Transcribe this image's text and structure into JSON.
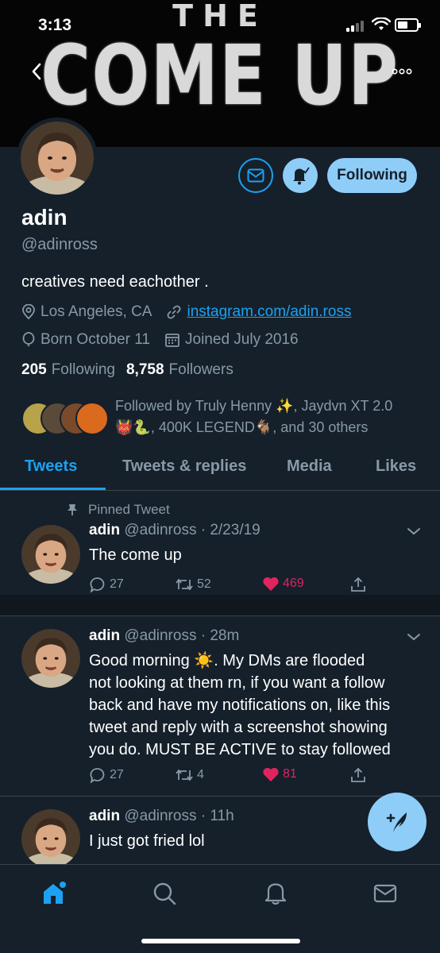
{
  "status_bar": {
    "time": "3:13"
  },
  "banner": {
    "line1": "THE",
    "line2": "COME UP"
  },
  "header_buttons": {
    "follow_label": "Following"
  },
  "profile": {
    "name": "adin",
    "handle": "@adinross",
    "bio": "creatives need eachother .",
    "location": "Los Angeles, CA",
    "website": "instagram.com/adin.ross",
    "birthday": "Born October 11",
    "joined": "Joined July 2016",
    "following_count": "205",
    "following_label": "Following",
    "followers_count": "8,758",
    "followers_label": "Followers",
    "followed_by_line1": "Followed by Truly Henny ✨, Jaydvn XT 2.0",
    "followed_by_line2": "👹🐍, 400K LEGEND🐐, and 30 others"
  },
  "tabs": [
    {
      "label": "Tweets",
      "active": true
    },
    {
      "label": "Tweets & replies",
      "active": false
    },
    {
      "label": "Media",
      "active": false
    },
    {
      "label": "Likes",
      "active": false
    }
  ],
  "tweets": [
    {
      "pinned_label": "Pinned Tweet",
      "name": "adin",
      "handle": "@adinross",
      "time": "· 2/23/19",
      "text": "The come up",
      "replies": "27",
      "retweets": "52",
      "likes": "469"
    },
    {
      "name": "adin",
      "handle": "@adinross",
      "time": "· 28m",
      "text_lines": [
        "Good morning ☀️.  My DMs are flooded",
        "not looking at them rn, if you want a follow",
        "back and have my notifications on, like this",
        "tweet and reply with a screenshot showing",
        "you do.  MUST BE ACTIVE to stay followed"
      ],
      "replies": "27",
      "retweets": "4",
      "likes": "81"
    },
    {
      "name": "adin",
      "handle": "@adinross",
      "time": "· 11h",
      "text": "I just got fried lol"
    }
  ],
  "colors": {
    "background": "#15202b",
    "accent": "#1da1f2",
    "muted": "#8899a6",
    "like": "#e0245e",
    "button_fill": "#8ecdf8"
  },
  "icons": [
    "back-icon",
    "more-icon",
    "mail-icon",
    "bell-icon",
    "location-icon",
    "link-icon",
    "balloon-icon",
    "calendar-icon",
    "pin-icon",
    "reply-icon",
    "retweet-icon",
    "heart-icon",
    "share-icon",
    "compose-icon",
    "home-icon",
    "search-icon",
    "notifications-icon",
    "messages-icon"
  ]
}
